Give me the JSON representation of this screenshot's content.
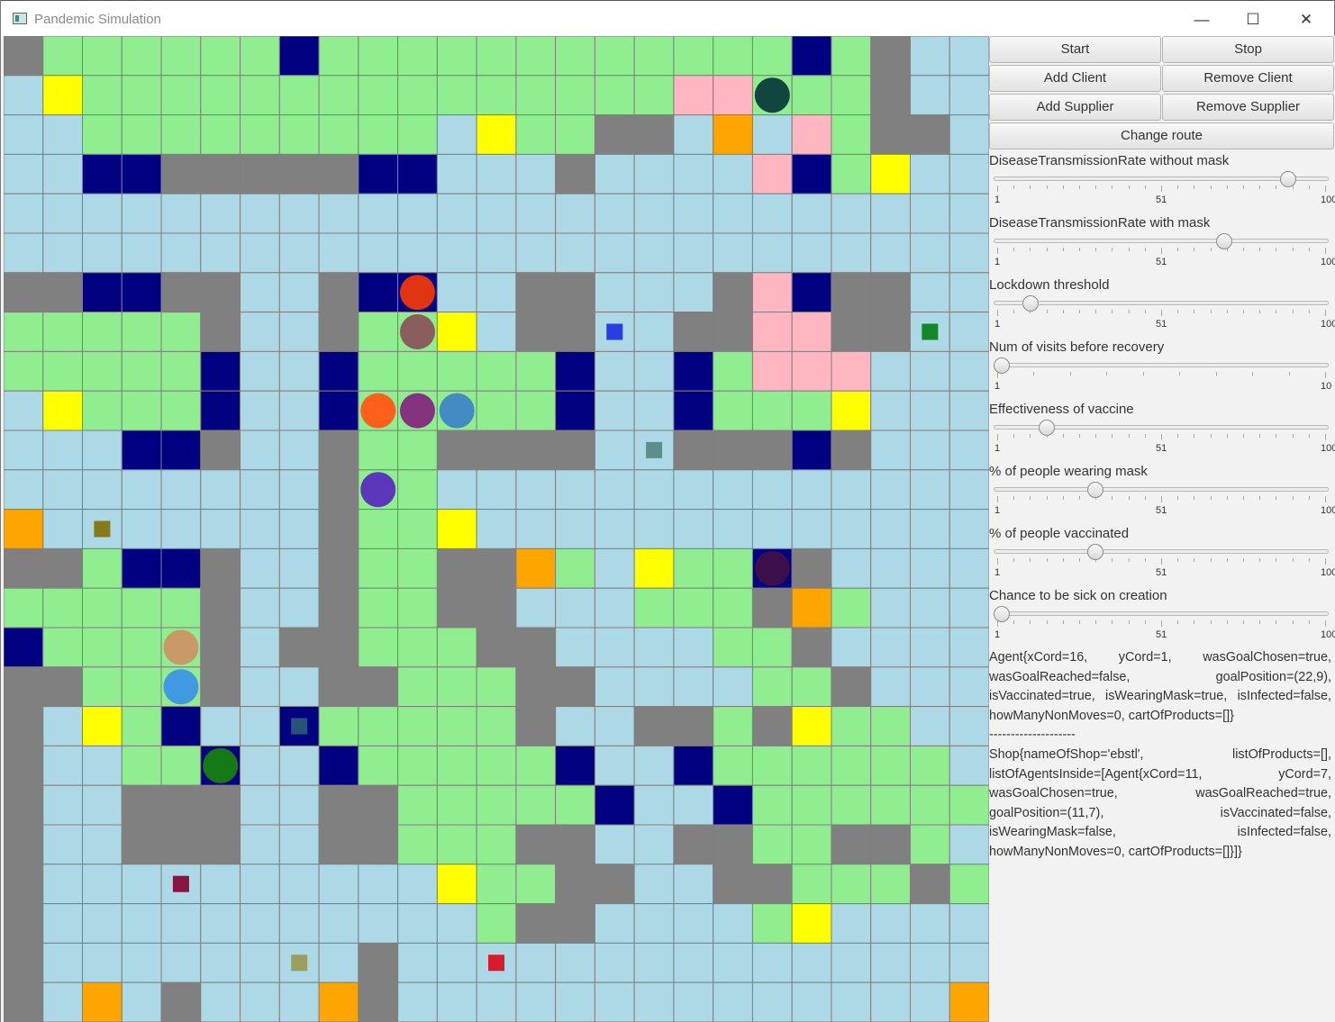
{
  "window": {
    "title": "Pandemic Simulation",
    "minimize_glyph": "—",
    "maximize_glyph": "☐",
    "close_glyph": "✕"
  },
  "colors": {
    "road": "#add8e6",
    "grass": "#90ee90",
    "wall": "#808080",
    "house": "#000080",
    "shop": "#ffff00",
    "pharmacy": "#ffa500",
    "hospital": "#ffb6c1",
    "gridline": "#7f7f7f"
  },
  "map": {
    "legend": "g=grass r=road w=wall n=house y=shop o=pharmacy p=hospital",
    "rows": [
      "wggggggnggggggggggggngw",
      "rygggggggggggggggppgggw",
      "rrgggggggggryggwwrorpgww",
      "rrnnwwwwwnnrrrwrrrrpngyrr",
      "rrrrrrrrrrrrrrrrrrrrrrrrr",
      "rrrrrrrrrrrrrrrrrrrrrrrrr",
      "wwnnwwrrwnnrrwwrrrwpnwwrr",
      "gggggwrrwggyrwwrrwwppwwrr",
      "gggggnrrngggggnrrngppprr",
      "rygggnrrngggggnrrngggyrr",
      "rrrnnwrrwggwwwwrrwwwnwrr",
      "rrrrrrrrwggrrrrrrrrrrrrr",
      "orrrrrrrwggyrrrrrrrrrrrr",
      "wwgnnwrrwggwwogryggnwrr",
      "gggggwrrwggwwrrrgggwog",
      "nggggwrwwgggwwrrrrggwrr",
      "wwgggwrrwwgggwwrrrrggwrr",
      "wrygnrrngggggwrrwwgwygg",
      "wrrggnrrngggggnrrngggggg",
      "wrrwwwrrwwgggggnrrngggggg",
      "wrrwwwrrwwgggwwrrwwggwwgr",
      "wrrrrrrrrrryggwwrrwwgggwgn",
      "wrrrrrrrrrrrgwwrrrrgyrrrr",
      "wrrrrrrrrwrrrrrrrrrrrrrr",
      "wrorwrrrowrrrrrrrrrrrrrro"
    ]
  },
  "agents": [
    {
      "col": 19,
      "row": 1,
      "color": "#114640",
      "shape": "circle"
    },
    {
      "col": 10,
      "row": 6,
      "color": "#e03412",
      "shape": "circle"
    },
    {
      "col": 10,
      "row": 7,
      "color": "#8a5e5c",
      "shape": "circle"
    },
    {
      "col": 15,
      "row": 7,
      "color": "#2a3fe0",
      "shape": "square"
    },
    {
      "col": 23,
      "row": 7,
      "color": "#15862a",
      "shape": "square"
    },
    {
      "col": 9,
      "row": 9,
      "color": "#fe5f1b",
      "shape": "circle"
    },
    {
      "col": 10,
      "row": 9,
      "color": "#84337e",
      "shape": "circle"
    },
    {
      "col": 11,
      "row": 9,
      "color": "#448bc3",
      "shape": "circle"
    },
    {
      "col": 16,
      "row": 10,
      "color": "#5a8f8c",
      "shape": "square"
    },
    {
      "col": 9,
      "row": 11,
      "color": "#5b37bb",
      "shape": "circle"
    },
    {
      "col": 2,
      "row": 12,
      "color": "#857b19",
      "shape": "square"
    },
    {
      "col": 19,
      "row": 13,
      "color": "#3b0f4c",
      "shape": "circle"
    },
    {
      "col": 4,
      "row": 15,
      "color": "#c99a67",
      "shape": "circle"
    },
    {
      "col": 4,
      "row": 16,
      "color": "#4099e1",
      "shape": "circle"
    },
    {
      "col": 7,
      "row": 17,
      "color": "#255478",
      "shape": "square"
    },
    {
      "col": 5,
      "row": 18,
      "color": "#157a15",
      "shape": "circle"
    },
    {
      "col": 4,
      "row": 21,
      "color": "#8a1440",
      "shape": "square"
    },
    {
      "col": 7,
      "row": 23,
      "color": "#9b9f5c",
      "shape": "square"
    },
    {
      "col": 12,
      "row": 23,
      "color": "#d91c2c",
      "shape": "square"
    }
  ],
  "controls": {
    "start": "Start",
    "stop": "Stop",
    "add_client": "Add Client",
    "remove_client": "Remove Client",
    "add_supplier": "Add Supplier",
    "remove_supplier": "Remove Supplier",
    "change_route": "Change route"
  },
  "sliders": [
    {
      "label": "DiseaseTransmissionRate without mask",
      "min": 1,
      "max": 100,
      "value": 90,
      "ticks": [
        "1",
        "51",
        "100"
      ]
    },
    {
      "label": "DiseaseTransmissionRate with mask",
      "min": 1,
      "max": 100,
      "value": 70,
      "ticks": [
        "1",
        "51",
        "100"
      ]
    },
    {
      "label": "Lockdown threshold",
      "min": 1,
      "max": 100,
      "value": 10,
      "ticks": [
        "1",
        "51",
        "100"
      ]
    },
    {
      "label": "Num of visits before recovery",
      "min": 1,
      "max": 10,
      "value": 1,
      "ticks": [
        "1",
        "10"
      ]
    },
    {
      "label": "Effectiveness of vaccine",
      "min": 1,
      "max": 100,
      "value": 15,
      "ticks": [
        "1",
        "51",
        "100"
      ]
    },
    {
      "label": "% of people wearing mask",
      "min": 1,
      "max": 100,
      "value": 30,
      "ticks": [
        "1",
        "51",
        "100"
      ]
    },
    {
      "label": "% of people vaccinated",
      "min": 1,
      "max": 100,
      "value": 30,
      "ticks": [
        "1",
        "51",
        "100"
      ]
    },
    {
      "label": "Chance to be sick on creation",
      "min": 1,
      "max": 100,
      "value": 1,
      "ticks": [
        "1",
        "51",
        "100"
      ]
    }
  ],
  "info": {
    "agent_text": "Agent{xCord=16, yCord=1, wasGoalChosen=true, wasGoalReached=false, goalPosition=(22,9), isVaccinated=true, isWearingMask=true, isInfected=false, howManyNonMoves=0, cartOfProducts=[]}",
    "separator": "--------------------",
    "shop_text": "Shop{nameOfShop='ebstl', listOfProducts=[], listOfAgentsInside=[Agent{xCord=11, yCord=7, wasGoalChosen=true, wasGoalReached=true, goalPosition=(11,7), isVaccinated=false, isWearingMask=false, isInfected=false, howManyNonMoves=0, cartOfProducts=[]}]}"
  }
}
